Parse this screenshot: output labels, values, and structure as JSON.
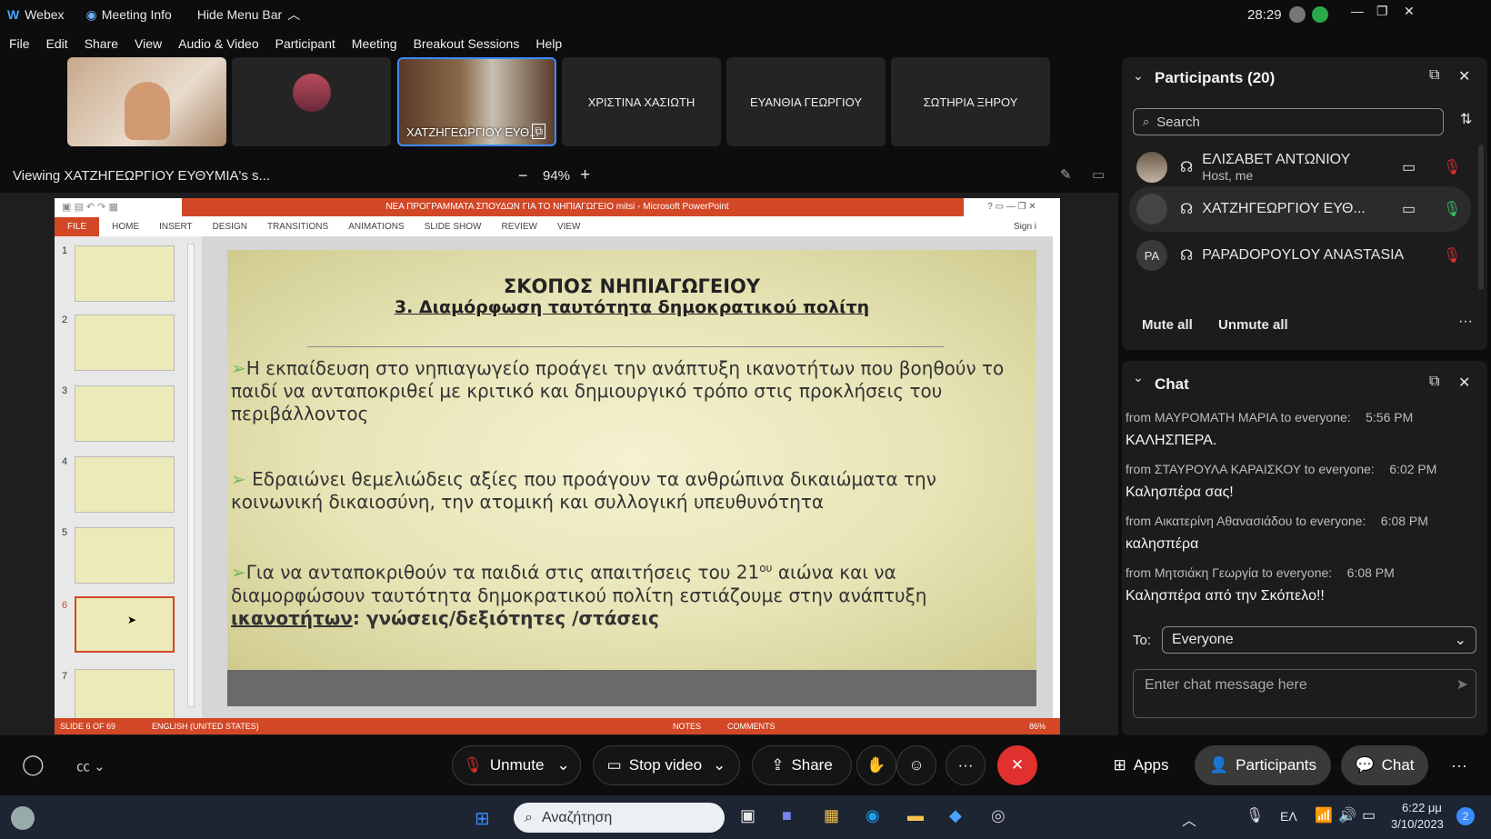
{
  "app": {
    "name": "Webex",
    "meeting_info": "Meeting Info",
    "hide_menu": "Hide Menu Bar",
    "timer": "28:29"
  },
  "menu": [
    "File",
    "Edit",
    "Share",
    "View",
    "Audio & Video",
    "Participant",
    "Meeting",
    "Breakout Sessions",
    "Help"
  ],
  "thumbnails": [
    {
      "label": ""
    },
    {
      "label": ""
    },
    {
      "label": "ΧΑΤΖΗΓΕΩΡΓΙΟΥ ΕΥΘ..."
    },
    {
      "label": "ΧΡΙΣΤΙΝΑ ΧΑΣΙΩΤΗ"
    },
    {
      "label": "ΕΥΑΝΘΙΑ ΓΕΩΡΓΙΟΥ"
    },
    {
      "label": "ΣΩΤΗΡΙΑ ΞΗΡΟΥ"
    }
  ],
  "viewing": "Viewing ΧΑΤΖΗΓΕΩΡΓΙΟΥ ΕΥΘΥΜΙΑ's s...",
  "zoom": "94%",
  "ppt": {
    "title": "ΝΕΑ ΠΡΟΓΡΑΜΜΑΤΑ ΣΠΟΥΔΩΝ ΓΙΑ ΤΟ ΝΗΠΙΑΓΩΓΕΙΟ mitsi - Microsoft PowerPoint",
    "tabs": [
      "FILE",
      "HOME",
      "INSERT",
      "DESIGN",
      "TRANSITIONS",
      "ANIMATIONS",
      "SLIDE SHOW",
      "REVIEW",
      "VIEW"
    ],
    "sign_in": "Sign i",
    "status_slide": "SLIDE 6 OF 69",
    "status_lang": "ENGLISH (UNITED STATES)",
    "notes": "NOTES",
    "comments": "COMMENTS",
    "zoom": "86%",
    "thumb_numbers": [
      "1",
      "2",
      "3",
      "4",
      "5",
      "6",
      "7"
    ]
  },
  "slide": {
    "title1": "ΣΚΟΠΟΣ ΝΗΠΙΑΓΩΓΕΙΟΥ",
    "title2": "3. Διαμόρφωση ταυτότητα δημοκρατικού πολίτη",
    "b1": "Η εκπαίδευση στο νηπιαγωγείο προάγει την ανάπτυξη ικανοτήτων που βοηθούν το παιδί να ανταποκριθεί με κριτικό και δημιουργικό τρόπο στις προκλήσεις του περιβάλλοντος",
    "b2": "Εδραιώνει θεμελιώδεις αξίες που προάγουν τα ανθρώπινα δικαιώματα την κοινωνική δικαιοσύνη, την ατομική και συλλογική υπευθυνότητα",
    "b3a": "Για να ανταποκριθούν τα παιδιά στις απαιτήσεις του 21",
    "b3sup": "ου",
    "b3b": " αιώνα και να διαμορφώσουν ταυτότητα δημοκρατικού πολίτη εστιάζουμε στην ανάπτυξη ",
    "b3u": "ικανοτήτων",
    "b3c": ": γνώσεις/δεξιότητες /στάσεις"
  },
  "participants": {
    "header": "Participants (20)",
    "search_placeholder": "Search",
    "list": [
      {
        "name": "ΕΛΙΣΑΒΕΤ ΑΝΤΩΝΙΟΥ",
        "sub": "Host, me",
        "initials": ""
      },
      {
        "name": "ΧΑΤΖΗΓΕΩΡΓΙΟΥ ΕΥΘ...",
        "sub": "",
        "initials": ""
      },
      {
        "name": "PAPADOPOYLOY ANASTASIA",
        "sub": "",
        "initials": "PA"
      }
    ],
    "mute_all": "Mute all",
    "unmute_all": "Unmute all"
  },
  "chat": {
    "header": "Chat",
    "messages": [
      {
        "from": "from ΜΑΥΡΟΜΑΤΗ ΜΑΡΙΑ to everyone:",
        "time": "5:56 PM",
        "text": "ΚΑΛΗΣΠΕΡΑ."
      },
      {
        "from": "from ΣΤΑΥΡΟΥΛΑ ΚΑΡΑΙΣΚΟΥ to everyone:",
        "time": "6:02 PM",
        "text": "Καλησπέρα σας!"
      },
      {
        "from": "from Αικατερίνη Αθανασιάδου to everyone:",
        "time": "6:08 PM",
        "text": "καλησπέρα"
      },
      {
        "from": "from Μητσιάκη Γεωργία to everyone:",
        "time": "6:08 PM",
        "text": "Καλησπέρα από την Σκόπελο!!"
      }
    ],
    "to_label": "To:",
    "to_value": "Everyone",
    "input_placeholder": "Enter chat message here"
  },
  "controls": {
    "unmute": "Unmute",
    "stop_video": "Stop video",
    "share": "Share",
    "apps": "Apps",
    "participants": "Participants",
    "chat": "Chat"
  },
  "taskbar": {
    "search": "Αναζήτηση",
    "lang": "ΕΛ",
    "time": "6:22 μμ",
    "date": "3/10/2023",
    "badge": "2"
  },
  "colors": {
    "accent_red": "#e0312f",
    "ppt_orange": "#d24726",
    "active_blue": "#3b8cff",
    "mic_green": "#3cc46a"
  }
}
